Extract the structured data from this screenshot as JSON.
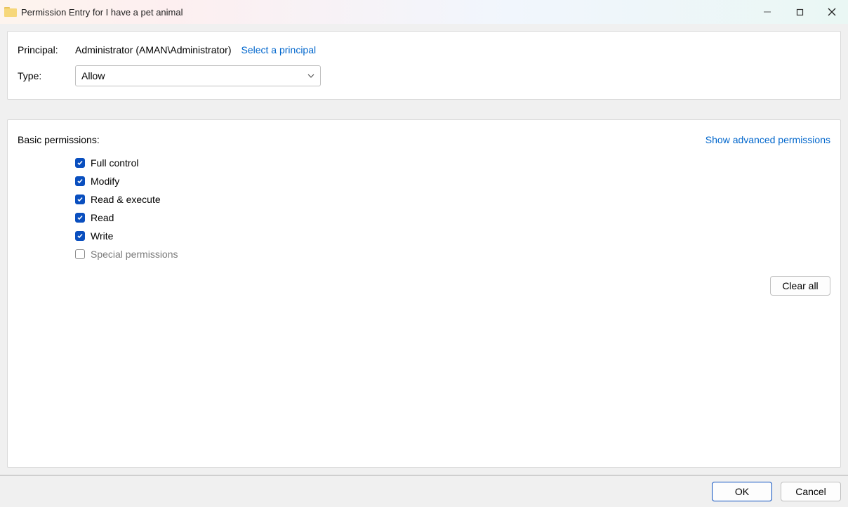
{
  "window": {
    "title": "Permission Entry for I have a pet animal"
  },
  "top_panel": {
    "principal_label": "Principal:",
    "principal_value": "Administrator (AMAN\\Administrator)",
    "select_principal_link": "Select a principal",
    "type_label": "Type:",
    "type_value": "Allow"
  },
  "permissions_panel": {
    "heading": "Basic permissions:",
    "advanced_link": "Show advanced permissions",
    "clear_all_label": "Clear all",
    "items": [
      {
        "label": "Full control",
        "checked": true,
        "disabled": false
      },
      {
        "label": "Modify",
        "checked": true,
        "disabled": false
      },
      {
        "label": "Read & execute",
        "checked": true,
        "disabled": false
      },
      {
        "label": "Read",
        "checked": true,
        "disabled": false
      },
      {
        "label": "Write",
        "checked": true,
        "disabled": false
      },
      {
        "label": "Special permissions",
        "checked": false,
        "disabled": true
      }
    ]
  },
  "footer": {
    "ok_label": "OK",
    "cancel_label": "Cancel"
  }
}
